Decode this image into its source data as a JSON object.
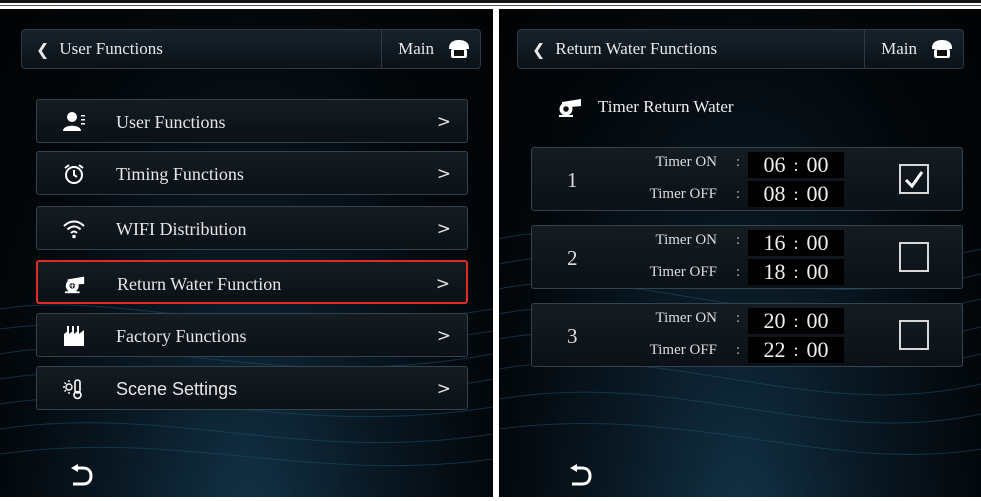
{
  "left": {
    "header": {
      "back_label": "User Functions",
      "main_label": "Main"
    },
    "menu": [
      {
        "label": "User Functions",
        "icon": "user-icon"
      },
      {
        "label": "Timing Functions",
        "icon": "alarm-clock-icon"
      },
      {
        "label": "WIFI Distribution",
        "icon": "wifi-icon"
      },
      {
        "label": "Return Water Function",
        "icon": "pump-icon",
        "selected": true
      },
      {
        "label": "Factory Functions",
        "icon": "factory-icon"
      },
      {
        "label": "Scene Settings",
        "icon": "thermometer-icon"
      }
    ]
  },
  "right": {
    "header": {
      "back_label": "Return Water Functions",
      "main_label": "Main"
    },
    "section_title": "Timer Return Water",
    "timers": [
      {
        "index": "1",
        "on_label": "Timer ON",
        "off_label": "Timer OFF",
        "on_h": "06",
        "on_m": "00",
        "off_h": "08",
        "off_m": "00",
        "checked": true
      },
      {
        "index": "2",
        "on_label": "Timer ON",
        "off_label": "Timer OFF",
        "on_h": "16",
        "on_m": "00",
        "off_h": "18",
        "off_m": "00",
        "checked": false
      },
      {
        "index": "3",
        "on_label": "Timer ON",
        "off_label": "Timer OFF",
        "on_h": "20",
        "on_m": "00",
        "off_h": "22",
        "off_m": "00",
        "checked": false
      }
    ]
  },
  "colors": {
    "selected_border": "#e02a22",
    "panel_bg": "#03080c",
    "text": "#e6e6e6"
  }
}
